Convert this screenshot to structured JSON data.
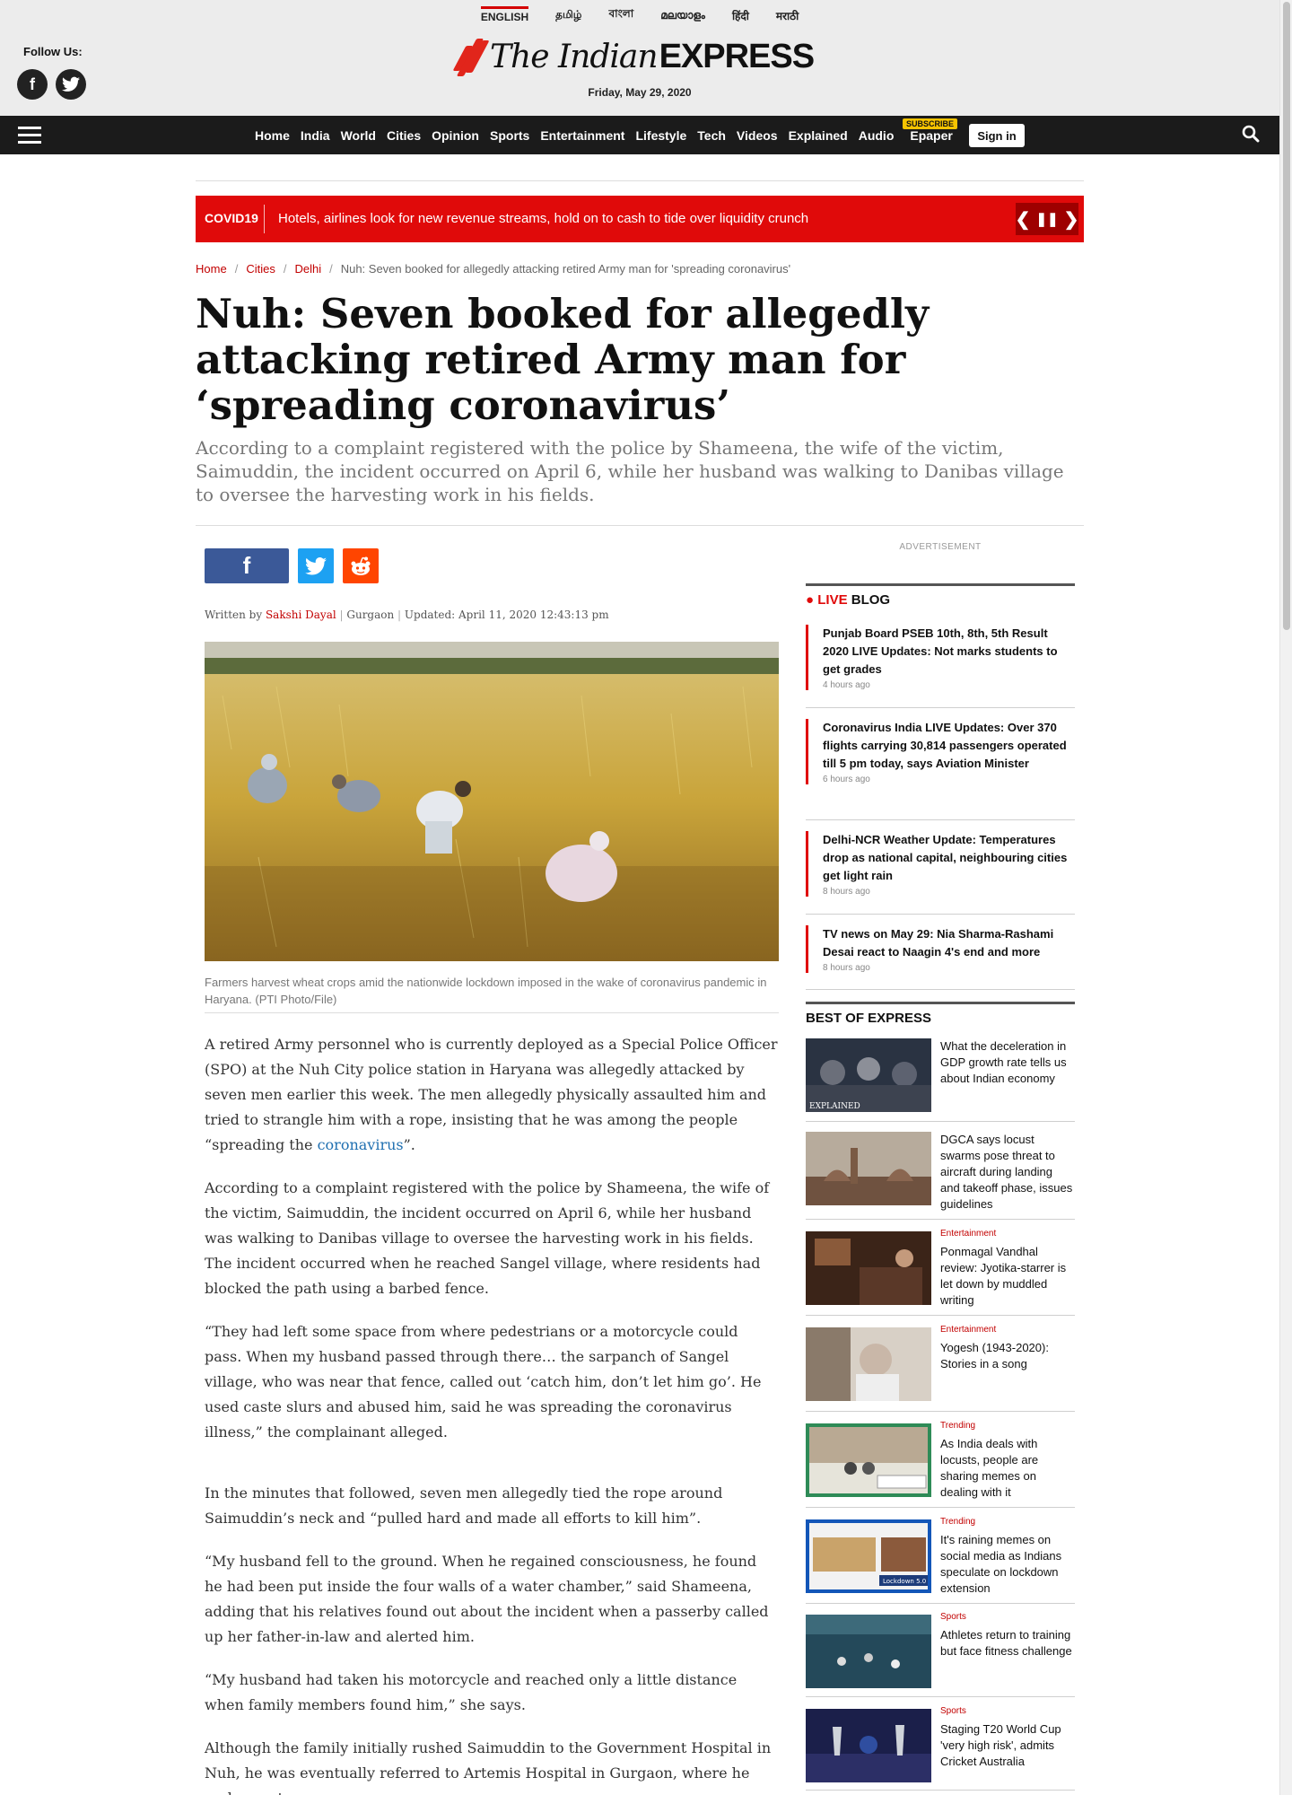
{
  "langs": [
    "ENGLISH",
    "தமிழ்",
    "বাংলা",
    "മലയാളം",
    "हिंदी",
    "मराठी"
  ],
  "header": {
    "follow_label": "Follow Us:",
    "logo_part1": "The Indian",
    "logo_part2": "EXPRESS",
    "date": "Friday, May 29, 2020"
  },
  "nav": {
    "links": [
      "Home",
      "India",
      "World",
      "Cities",
      "Opinion",
      "Sports",
      "Entertainment",
      "Lifestyle",
      "Tech",
      "Videos",
      "Explained",
      "Audio",
      "Epaper"
    ],
    "subscribe_badge": "SUBSCRIBE",
    "signin": "Sign in"
  },
  "ticker": {
    "tag": "COVID19",
    "headline": "Hotels, airlines look for new revenue streams, hold on to cash to tide over liquidity crunch",
    "prev": "❮",
    "pause": "❚❚",
    "next": "❯"
  },
  "breadcrumb": {
    "home": "Home",
    "cities": "Cities",
    "delhi": "Delhi",
    "current": "Nuh: Seven booked for allegedly attacking retired Army man for 'spreading coronavirus'"
  },
  "article": {
    "title": "Nuh: Seven booked for allegedly attacking retired Army man for ‘spreading coronavirus’",
    "synopsis": "According to a complaint registered with the police by Shameena, the wife of the victim, Saimuddin, the incident occurred on April 6, while her husband was walking to Danibas village to oversee the harvesting work in his fields.",
    "byline_prefix": "Written by",
    "author": "Sakshi Dayal",
    "location": "Gurgaon",
    "updated": "Updated: April 11, 2020 12:43:13 pm",
    "caption": "Farmers harvest wheat crops amid the nationwide lockdown imposed in the wake of coronavirus pandemic in Haryana. (PTI Photo/File)",
    "p1_text": "A retired Army personnel who is currently deployed as a Special Police Officer (SPO) at the Nuh City police station in Haryana was allegedly attacked by seven men earlier this week. The men allegedly physically assaulted him and tried to strangle him with a rope, insisting that he was among the people “spreading the ",
    "p1_link": "coronavirus",
    "p1_end": "”.",
    "p2": "According to a complaint registered with the police by Shameena, the wife of the victim, Saimuddin, the incident occurred on April 6, while her husband was walking to Danibas village to oversee the harvesting work in his fields. The incident occurred when he reached Sangel village, where residents had blocked the path using a barbed fence.",
    "p3": "“They had left some space from where pedestrians or a motorcycle could pass. When my husband passed through there… the sarpanch of Sangel village, who was near that fence, called out ‘catch him, don’t let him go’. He used caste slurs and abused him, said he was spreading the coronavirus illness,” the complainant alleged.",
    "p4": "In the minutes that followed, seven men allegedly tied the rope around Saimuddin’s neck and “pulled hard and made all efforts to kill him”.",
    "p5": "“My husband fell to the ground. When he regained consciousness, he found he had been put inside the four walls of a water chamber,” said Shameena, adding that his relatives found out about the incident when a passerby called up her father-in-law and alerted him.",
    "p6": "“My husband had taken his motorcycle and reached only a little distance when family members found him,” she says.",
    "p7": "Although the family initially rushed Saimuddin to the Government Hospital in Nuh, he was eventually referred to Artemis Hospital in Gurgaon, where he underwent"
  },
  "sidebar": {
    "ad_label": "ADVERTISEMENT",
    "live_label": "LIVE",
    "blog_label": "BLOG",
    "live_items": [
      {
        "title": "Punjab Board PSEB 10th, 8th, 5th Result 2020 LIVE Updates: Not marks students to get grades",
        "time": "4 hours ago"
      },
      {
        "title": "Coronavirus India LIVE Updates: Over 370 flights carrying 30,814 passengers operated till 5 pm today, says Aviation Minister",
        "time": "6 hours ago"
      },
      {
        "title": "Delhi-NCR Weather Update: Temperatures drop as national capital, neighbouring cities get light rain",
        "time": "8 hours ago"
      },
      {
        "title": "TV news on May 29: Nia Sharma-Rashami Desai react to Naagin 4's end and more",
        "time": "8 hours ago"
      }
    ],
    "best_label": "BEST OF EXPRESS",
    "best_items": [
      {
        "category": "",
        "title": "What the deceleration in GDP growth rate tells us about Indian economy"
      },
      {
        "category": "",
        "title": "DGCA says locust swarms pose threat to aircraft during landing and takeoff phase, issues guidelines"
      },
      {
        "category": "Entertainment",
        "title": "Ponmagal Vandhal review: Jyotika-starrer is let down by muddled writing"
      },
      {
        "category": "Entertainment",
        "title": "Yogesh (1943-2020): Stories in a song"
      },
      {
        "category": "Trending",
        "title": "As India deals with locusts, people are sharing memes on dealing with it"
      },
      {
        "category": "Trending",
        "title": "It's raining memes on social media as Indians speculate on lockdown extension"
      },
      {
        "category": "Sports",
        "title": "Athletes return to training but face fitness challenge"
      },
      {
        "category": "Sports",
        "title": "Staging T20 World Cup 'very high risk', admits Cricket Australia"
      }
    ],
    "thumb_texts": {
      "explained": "EXPLAINED",
      "lockdown": "Lockdown 5.0"
    }
  },
  "colors": {
    "brand_red": "#e00a0a",
    "nav_bg": "#1b1b1b",
    "header_bg": "#ececec"
  }
}
